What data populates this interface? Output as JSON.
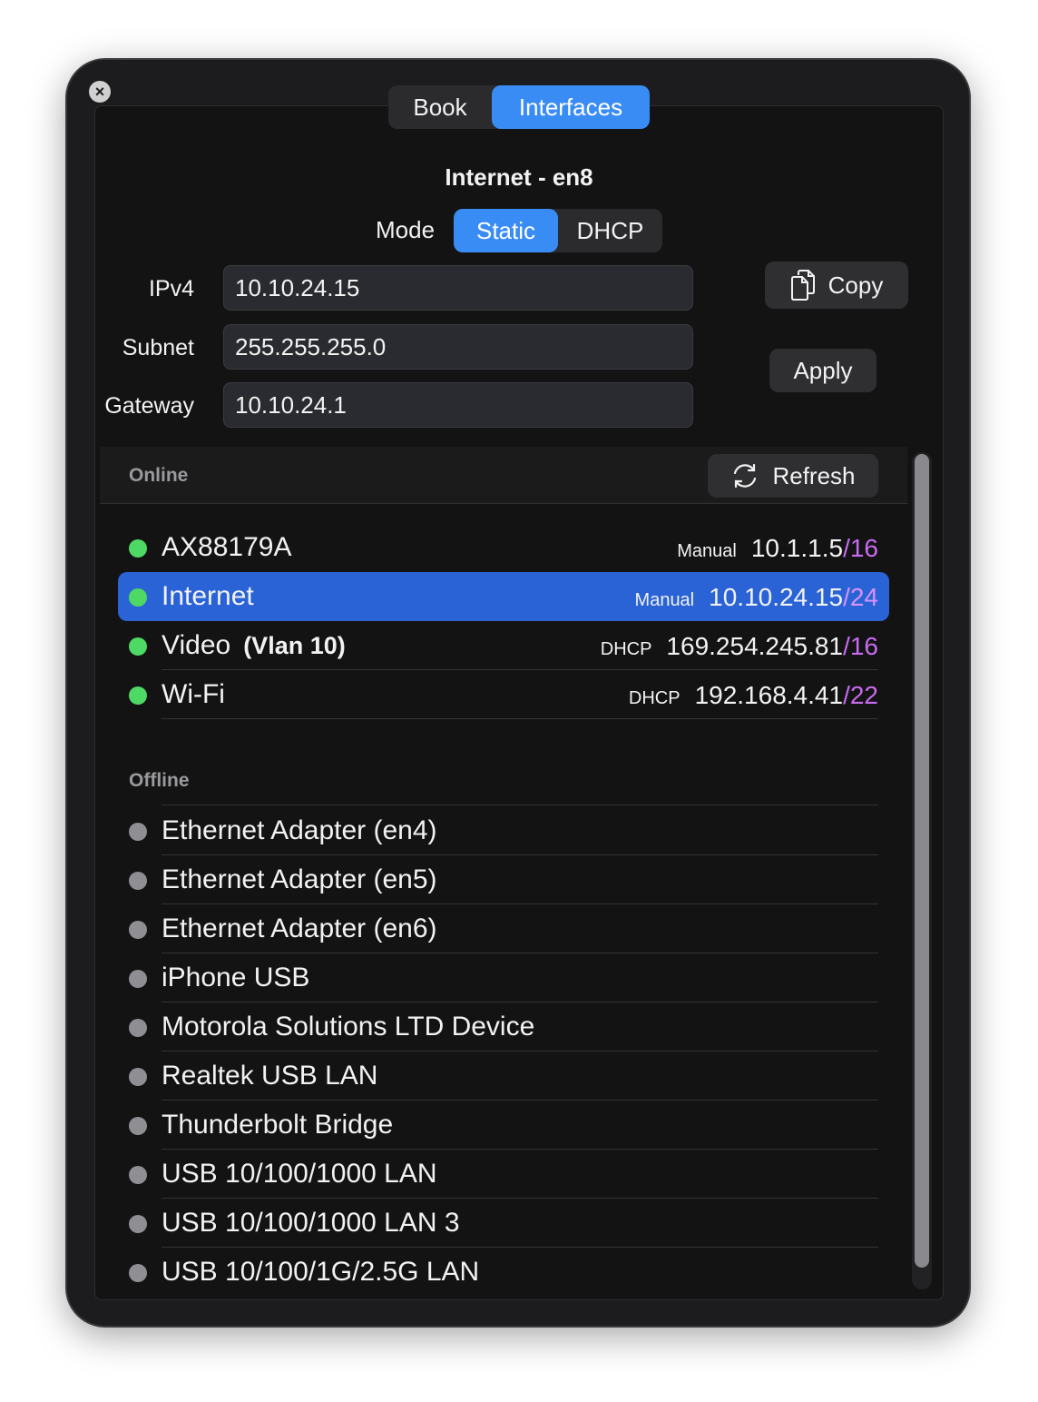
{
  "tabs": {
    "book": "Book",
    "interfaces": "Interfaces"
  },
  "interface_title": "Internet - en8",
  "mode": {
    "label": "Mode",
    "options": [
      "Static",
      "DHCP"
    ],
    "selected": "Static"
  },
  "fields": {
    "ipv4": {
      "label": "IPv4",
      "value": "10.10.24.15"
    },
    "subnet": {
      "label": "Subnet",
      "value": "255.255.255.0"
    },
    "gateway": {
      "label": "Gateway",
      "value": "10.10.24.1"
    }
  },
  "buttons": {
    "copy": "Copy",
    "apply": "Apply",
    "refresh": "Refresh"
  },
  "online": {
    "title": "Online",
    "items": [
      {
        "name": "AX88179A",
        "vlan": "",
        "kind": "Manual",
        "ip": "10.1.1.5",
        "mask": "/16",
        "selected": false
      },
      {
        "name": "Internet",
        "vlan": "",
        "kind": "Manual",
        "ip": "10.10.24.15",
        "mask": "/24",
        "selected": true
      },
      {
        "name": "Video",
        "vlan": "(Vlan 10)",
        "kind": "DHCP",
        "ip": "169.254.245.81",
        "mask": "/16",
        "selected": false
      },
      {
        "name": "Wi-Fi",
        "vlan": "",
        "kind": "DHCP",
        "ip": "192.168.4.41",
        "mask": "/22",
        "selected": false
      }
    ]
  },
  "offline": {
    "title": "Offline",
    "items": [
      "Ethernet Adapter (en4)",
      "Ethernet Adapter (en5)",
      "Ethernet Adapter (en6)",
      "iPhone USB",
      "Motorola Solutions LTD Device",
      "Realtek USB LAN",
      "Thunderbolt Bridge",
      "USB 10/100/1000 LAN",
      "USB 10/100/1000 LAN 3",
      "USB 10/100/1G/2.5G LAN"
    ]
  },
  "colors": {
    "accent": "#3a8cf5",
    "selected_row": "#2a63d6",
    "online_dot": "#4dd964",
    "offline_dot": "#8e8e93",
    "mask": "#c86bf0"
  },
  "icons": {
    "close": "close-icon",
    "copy": "copy-icon",
    "refresh": "refresh-icon"
  }
}
